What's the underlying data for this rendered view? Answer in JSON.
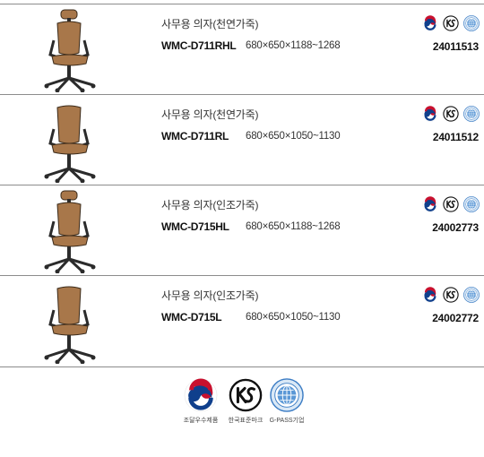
{
  "products": [
    {
      "name": "사무용 의자(천연가죽)",
      "model": "WMC-D711RHL",
      "dims": "680×650×1188~1268",
      "code": "24011513",
      "headrest": true
    },
    {
      "name": "사무용 의자(천연가죽)",
      "model": "WMC-D711RL",
      "dims": "680×650×1050~1130",
      "code": "24011512",
      "headrest": false
    },
    {
      "name": "사무용 의자(인조가죽)",
      "model": "WMC-D715HL",
      "dims": "680×650×1188~1268",
      "code": "24002773",
      "headrest": true
    },
    {
      "name": "사무용 의자(인조가죽)",
      "model": "WMC-D715L",
      "dims": "680×650×1050~1130",
      "code": "24002772",
      "headrest": false
    }
  ],
  "legend": [
    {
      "icon": "taegeuk-icon",
      "label": "조달우수제품"
    },
    {
      "icon": "ks-mark-icon",
      "label": "한국표준마크"
    },
    {
      "icon": "gpass-icon",
      "label": "G-PASS기업"
    }
  ],
  "gpass_text": "G-PASS",
  "colors": {
    "leather": "#a8774a",
    "frame": "#2b2b2b",
    "taegeuk_red": "#c8102e",
    "taegeuk_blue": "#0f3f8c",
    "gpass_blue": "#3b7cc4"
  }
}
